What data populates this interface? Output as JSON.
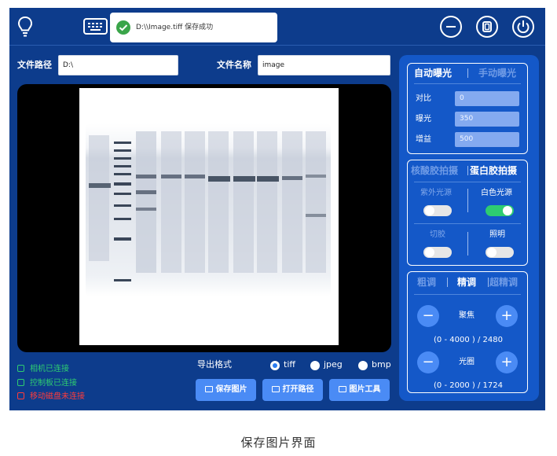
{
  "toast": {
    "message": "D:\\\\Image.tiff 保存成功"
  },
  "path_row": {
    "path_label": "文件路径",
    "path_value": "D:\\",
    "name_label": "文件名称",
    "name_value": "image"
  },
  "status": {
    "camera": "相机已连接",
    "control_board": "控制板已连接",
    "removable_disk": "移动磁盘未连接"
  },
  "export": {
    "label": "导出格式",
    "formats": [
      "tiff",
      "jpeg",
      "bmp"
    ],
    "selected": "tiff"
  },
  "actions": {
    "save": "保存图片",
    "open_path": "打开路径",
    "image_tools": "图片工具"
  },
  "exposure": {
    "tab_auto": "自动曝光",
    "tab_manual": "手动曝光",
    "active_tab": "自动曝光",
    "contrast_label": "对比",
    "contrast_value": "0",
    "exposure_label": "曝光",
    "exposure_value": "350",
    "gain_label": "增益",
    "gain_value": "500"
  },
  "capture_mode": {
    "tab_nucleic": "核酸胶拍摄",
    "tab_protein": "蛋白胶拍摄",
    "active_tab": "蛋白胶拍摄",
    "uv_label": "紫外光源",
    "uv_on": false,
    "white_label": "白色光源",
    "white_on": true,
    "cut_label": "切胶",
    "cut_on": false,
    "light_label": "照明",
    "light_on": false
  },
  "adjust": {
    "tab_coarse": "粗调",
    "tab_fine": "精调",
    "tab_ultra": "超精调",
    "active_tab": "精调",
    "focus_label": "聚焦",
    "focus_range": "(0 - 4000 ) / 2480",
    "aperture_label": "光圈",
    "aperture_range": "(0 - 2000 ) / 1724",
    "minus": "−",
    "plus": "+"
  },
  "caption": "保存图片界面",
  "colors": {
    "background": "#0d3c8c",
    "panel": "#1458c8",
    "button": "#4a8bf5",
    "status_ok": "#2ecc71",
    "status_error": "#ff3b3b",
    "toggle_on": "#2ecc71"
  }
}
